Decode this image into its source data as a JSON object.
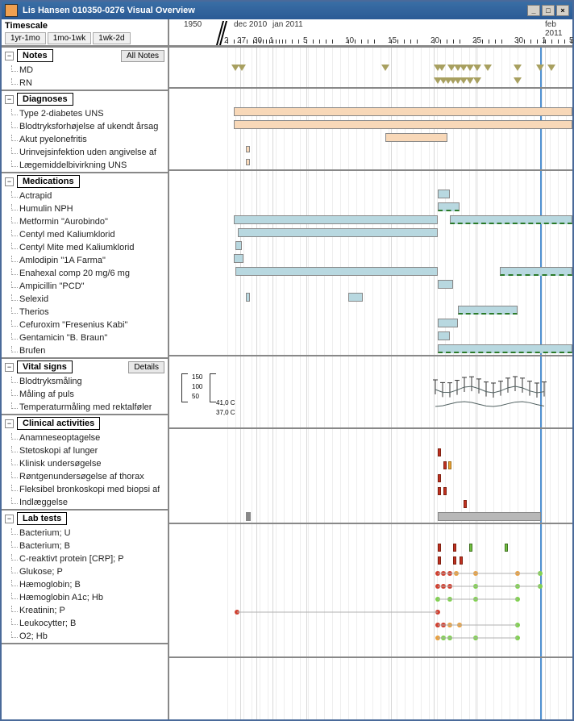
{
  "window": {
    "title": "Lis Hansen  010350-0276     Visual Overview",
    "controls": {
      "min": "_",
      "max": "□",
      "close": "×"
    }
  },
  "timescale": {
    "label": "Timescale",
    "buttons": [
      "1yr-1mo",
      "1mo-1wk",
      "1wk-2d"
    ]
  },
  "ruler": {
    "left_label": "1950",
    "periods": [
      "dec 2010",
      "jan 2011",
      "feb 2011"
    ],
    "ticks": [
      "2",
      "27",
      "30",
      "1",
      "5",
      "10",
      "15",
      "20",
      "25",
      "30",
      "1",
      "5"
    ]
  },
  "sections": {
    "notes": {
      "title": "Notes",
      "button": "All Notes",
      "rows": [
        "MD",
        "RN"
      ]
    },
    "diagnoses": {
      "title": "Diagnoses",
      "rows": [
        "Type 2-diabetes UNS",
        "Blodtryksforhøjelse af ukendt årsag",
        "Akut pyelonefritis",
        "Urinvejsinfektion uden angivelse af",
        "Lægemiddelbivirkning UNS"
      ]
    },
    "medications": {
      "title": "Medications",
      "rows": [
        "Actrapid",
        "Humulin NPH",
        "Metformin \"Aurobindo\"",
        "Centyl med Kaliumklorid",
        "Centyl Mite med Kaliumklorid",
        "Amlodipin \"1A Farma\"",
        "Enahexal comp 20 mg/6 mg",
        "Ampicillin \"PCD\"",
        "Selexid",
        "Therios",
        "Cefuroxim \"Fresenius Kabi\"",
        "Gentamicin \"B. Braun\"",
        "Brufen"
      ]
    },
    "vitals": {
      "title": "Vital signs",
      "button": "Details",
      "rows": [
        "Blodtryksmåling",
        "Måling af puls",
        "Temperaturmåling med rektalføler"
      ],
      "scale_bp": [
        "150",
        "100",
        "50"
      ],
      "scale_temp": [
        "41,0 C",
        "37,0 C"
      ]
    },
    "clinical": {
      "title": "Clinical activities",
      "rows": [
        "Anamneseoptagelse",
        "Stetoskopi af lunger",
        "Klinisk undersøgelse",
        "Røntgenundersøgelse af thorax",
        "Fleksibel bronkoskopi med biopsi af",
        "Indlæggelse"
      ]
    },
    "labs": {
      "title": "Lab tests",
      "rows": [
        "Bacterium; U",
        "Bacterium; B",
        "C-reaktivt protein [CRP]; P",
        "Glukose; P",
        "Hæmoglobin; B",
        "Hæmoglobin A1c; Hb",
        "Kreatinin; P",
        "Leukocytter; B",
        "O2; Hb"
      ]
    }
  },
  "chart_data": {
    "type": "timeline",
    "x_axis": {
      "start": "1950",
      "break_at": "2010-12-02",
      "end": "2011-02-05",
      "today": "2011-01-31"
    },
    "notes_markers": {
      "MD": [
        82,
        90,
        268,
        333,
        338,
        350,
        358,
        365,
        373,
        382,
        395,
        432,
        460,
        474
      ],
      "RN": [
        333,
        340,
        346,
        352,
        358,
        365,
        373,
        382,
        432
      ]
    },
    "diagnoses_bars": [
      {
        "row": 0,
        "start": 80,
        "end": 500
      },
      {
        "row": 1,
        "start": 80,
        "end": 500
      },
      {
        "row": 2,
        "start": 268,
        "end": 345
      },
      {
        "row": 3,
        "start": 95,
        "end": 100,
        "thin": true
      },
      {
        "row": 4,
        "start": 95,
        "end": 100,
        "thin": true
      }
    ],
    "medications_bars": [
      {
        "row": 0,
        "start": 333,
        "end": 348
      },
      {
        "row": 1,
        "start": 333,
        "end": 360,
        "dashed": true
      },
      {
        "row": 2,
        "start": 80,
        "end": 333
      },
      {
        "row": 2,
        "start": 348,
        "end": 500,
        "dashed": true
      },
      {
        "row": 3,
        "start": 85,
        "end": 333
      },
      {
        "row": 4,
        "start": 82,
        "end": 90
      },
      {
        "row": 5,
        "start": 80,
        "end": 92
      },
      {
        "row": 6,
        "start": 82,
        "end": 333
      },
      {
        "row": 6,
        "start": 410,
        "end": 500,
        "dashed": true
      },
      {
        "row": 7,
        "start": 333,
        "end": 352
      },
      {
        "row": 8,
        "start": 95,
        "end": 100
      },
      {
        "row": 8,
        "start": 222,
        "end": 240
      },
      {
        "row": 9,
        "start": 358,
        "end": 432,
        "dashed": true
      },
      {
        "row": 10,
        "start": 333,
        "end": 358
      },
      {
        "row": 11,
        "start": 333,
        "end": 348
      },
      {
        "row": 12,
        "start": 333,
        "end": 500,
        "dashed": true
      }
    ]
  }
}
